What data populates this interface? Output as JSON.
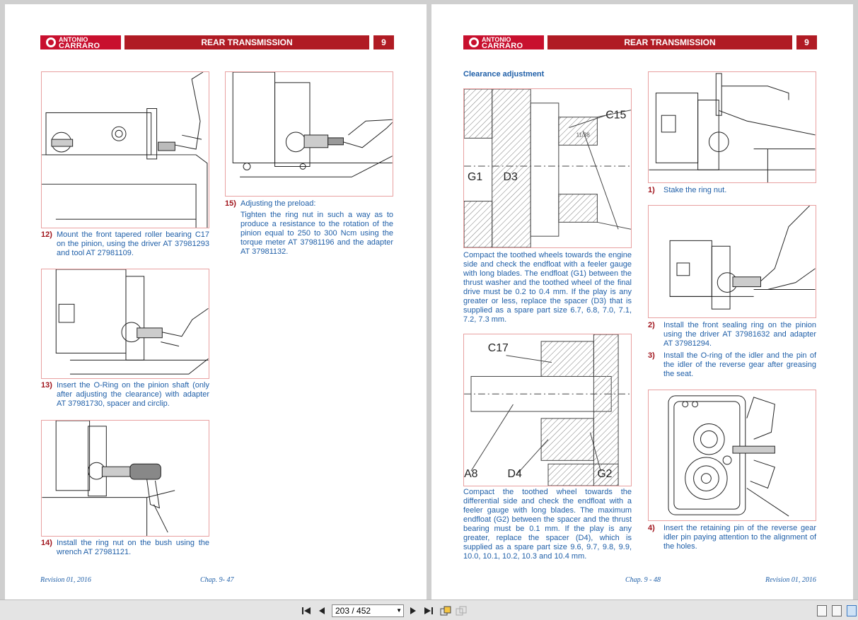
{
  "header": {
    "logo_line1": "ANTONIO",
    "logo_line2": "CARRARO",
    "title": "REAR TRANSMISSION",
    "section_number": "9"
  },
  "left_page": {
    "steps": [
      {
        "num": "12)",
        "text": "Mount the front tapered roller bearing C17 on the pinion, using the driver AT 37981293 and tool AT 27981109."
      },
      {
        "num": "13)",
        "text": "Insert the O-Ring on the pinion shaft (only after adjusting the clearance) with adapter AT 37981730, spacer and circlip."
      },
      {
        "num": "14)",
        "text": "Install the ring nut on the bush using the wrench AT 27981121."
      },
      {
        "num": "15)",
        "title": "Adjusting the preload:",
        "text": "Tighten the ring nut in such a way as to produce a resistance to the rotation of the pinion equal to 250 to 300 Ncm using the torque meter AT 37981196 and the adapter AT 37981132."
      }
    ],
    "footer_revision": "Revision 01, 2016",
    "footer_chapter": "Chap. 9- 47"
  },
  "right_page": {
    "section_title": "Clearance adjustment",
    "para1": "Compact the toothed wheels towards the engine side and check the endfloat with a feeler gauge with long blades. The endfloat (G1) between the thrust washer and the toothed wheel of the final drive must be 0.2 to 0.4 mm. If the play is any greater or less, replace the spacer (D3) that is supplied as a spare part size 6.7, 6.8, 7.0, 7.1, 7.2, 7.3 mm.",
    "para2": "Compact the toothed wheel towards the differential side and check the endfloat with a feeler gauge with long blades. The maximum endfloat (G2) between the spacer and the thrust bearing must be 0.1 mm. If the play is any greater, replace the spacer (D4), which is supplied as a spare part size 9.6, 9.7, 9.8, 9.9, 10.0, 10.1, 10.2, 10.3 and 10.4 mm.",
    "diagram1_labels": {
      "c15": "C15",
      "g1": "G1",
      "d3": "D3",
      "inner": "11/38"
    },
    "diagram2_labels": {
      "c17": "C17",
      "a8": "A8",
      "d4": "D4",
      "g2": "G2"
    },
    "steps": [
      {
        "num": "1)",
        "text": "Stake the ring nut."
      },
      {
        "num": "2)",
        "text": "Install the front sealing ring on the pinion using the driver AT 37981632 and adapter AT 37981294."
      },
      {
        "num": "3)",
        "text": "Install the O-ring of the idler and the pin of the idler of the reverse gear after greasing the seat."
      },
      {
        "num": "4)",
        "text": "Insert the retaining pin of the reverse gear idler pin paying attention to the alignment of the holes."
      }
    ],
    "footer_chapter": "Chap. 9 - 48",
    "footer_revision": "Revision 01, 2016"
  },
  "toolbar": {
    "page_indicator": "203 / 452",
    "icons": [
      "first-page-icon",
      "prev-page-icon",
      "next-page-icon",
      "last-page-icon",
      "rotate-icon",
      "fit-icon",
      "single-page-view-icon",
      "continuous-view-icon",
      "two-page-view-icon"
    ]
  }
}
